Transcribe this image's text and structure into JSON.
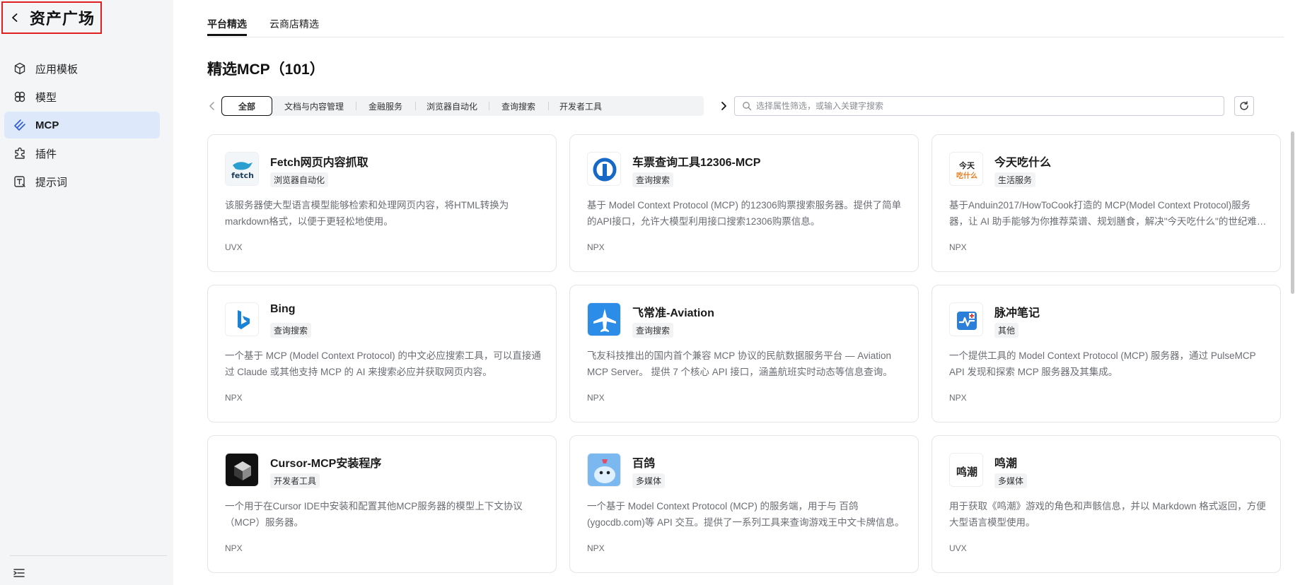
{
  "sidebar": {
    "back_title": "资产广场",
    "items": [
      {
        "label": "应用模板",
        "icon": "cube-icon"
      },
      {
        "label": "模型",
        "icon": "model-icon"
      },
      {
        "label": "MCP",
        "icon": "mcp-icon",
        "active": true
      },
      {
        "label": "插件",
        "icon": "plugin-icon"
      },
      {
        "label": "提示词",
        "icon": "prompt-icon"
      }
    ]
  },
  "tabs": [
    {
      "label": "平台精选",
      "active": true
    },
    {
      "label": "云商店精选"
    }
  ],
  "page_title": "精选MCP（101）",
  "filters": {
    "chips": [
      "全部",
      "文档与内容管理",
      "金融服务",
      "浏览器自动化",
      "查询搜索",
      "开发者工具"
    ],
    "active": "全部",
    "search_placeholder": "选择属性筛选，或输入关键字搜索"
  },
  "colors": {
    "accent_active_bg": "#dde9fb",
    "alert_border": "#e02020"
  },
  "cards": [
    {
      "name": "Fetch网页内容抓取",
      "tag": "浏览器自动化",
      "desc": "该服务器使大型语言模型能够检索和处理网页内容，将HTML转换为markdown格式，以便于更轻松地使用。",
      "runtime": "UVX",
      "logo": "fetch-logo",
      "logo_text": "fetch"
    },
    {
      "name": "车票查询工具12306-MCP",
      "tag": "查询搜索",
      "desc": "基于 Model Context Protocol (MCP) 的12306购票搜索服务器。提供了简单的API接口，允许大模型利用接口搜索12306购票信息。",
      "runtime": "NPX",
      "logo": "railway-logo"
    },
    {
      "name": "今天吃什么",
      "tag": "生活服务",
      "desc": "基于Anduin2017/HowToCook打造的 MCP(Model Context Protocol)服务器，让 AI 助手能够为你推荐菜谱、规划膳食，解决\"今天吃什么\"的世纪难题。",
      "runtime": "NPX",
      "logo": "food-logo",
      "logo_text": "今天吃什么"
    },
    {
      "name": "Bing",
      "tag": "查询搜索",
      "desc": "一个基于 MCP (Model Context Protocol) 的中文必应搜索工具，可以直接通过 Claude 或其他支持 MCP 的 AI 来搜索必应并获取网页内容。",
      "runtime": "NPX",
      "logo": "bing-logo"
    },
    {
      "name": "飞常准-Aviation",
      "tag": "查询搜索",
      "desc": "飞友科技推出的国内首个兼容 MCP 协议的民航数据服务平台 — Aviation MCP Server。 提供 7 个核心 API 接口，涵盖航班实时动态等信息查询。",
      "runtime": "NPX",
      "logo": "aviation-logo"
    },
    {
      "name": "脉冲笔记",
      "tag": "其他",
      "desc": "一个提供工具的 Model Context Protocol (MCP) 服务器，通过 PulseMCP API 发现和探索 MCP 服务器及其集成。",
      "runtime": "NPX",
      "logo": "pulse-logo"
    },
    {
      "name": "Cursor-MCP安装程序",
      "tag": "开发者工具",
      "desc": "一个用于在Cursor IDE中安装和配置其他MCP服务器的模型上下文协议（MCP）服务器。",
      "runtime": "NPX",
      "logo": "cursor-logo"
    },
    {
      "name": "百鸽",
      "tag": "多媒体",
      "desc": "一个基于 Model Context Protocol (MCP) 的服务端，用于与 百鸽(ygocdb.com)等 API 交互。提供了一系列工具来查询游戏王中文卡牌信息。",
      "runtime": "NPX",
      "logo": "pigeon-logo"
    },
    {
      "name": "鸣潮",
      "tag": "多媒体",
      "desc": "用于获取《鸣潮》游戏的角色和声骸信息，并以 Markdown 格式返回，方便大型语言模型使用。",
      "runtime": "UVX",
      "logo": "wuthering-logo",
      "logo_text": "鸣潮"
    }
  ]
}
